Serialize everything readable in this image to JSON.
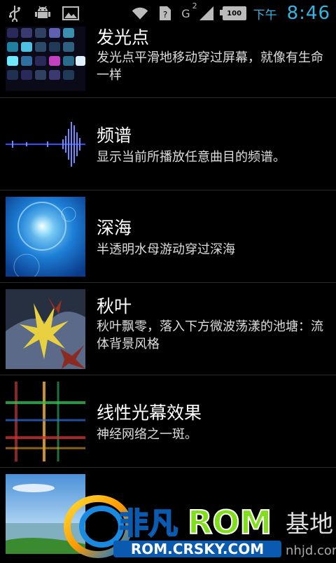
{
  "status_bar": {
    "icons_left": [
      "usb-icon",
      "android-debug-icon",
      "image-icon"
    ],
    "network": "G",
    "network_sup": "2",
    "battery": "100",
    "ampm": "下午",
    "time": "8:46"
  },
  "wallpapers": [
    {
      "title": "发光点",
      "desc": "发光点平滑地移动穿过屏幕，就像有生命一样"
    },
    {
      "title": "频谱",
      "desc": "显示当前所播放任意曲目的频谱。"
    },
    {
      "title": "深海",
      "desc": "半透明水母游动穿过深海"
    },
    {
      "title": "秋叶",
      "desc": "秋叶飘零，落入下方微波荡漾的池塘：流体背景风格"
    },
    {
      "title": "线性光幕效果",
      "desc": "神经网络之一斑。"
    },
    {
      "title": "",
      "desc": ""
    }
  ],
  "watermark": {
    "brand_cn": "非凡",
    "brand_en": "ROM",
    "site": "ROM.CRSKY.COM",
    "suffix": "基地",
    "url_partial": "nhjd.com"
  }
}
